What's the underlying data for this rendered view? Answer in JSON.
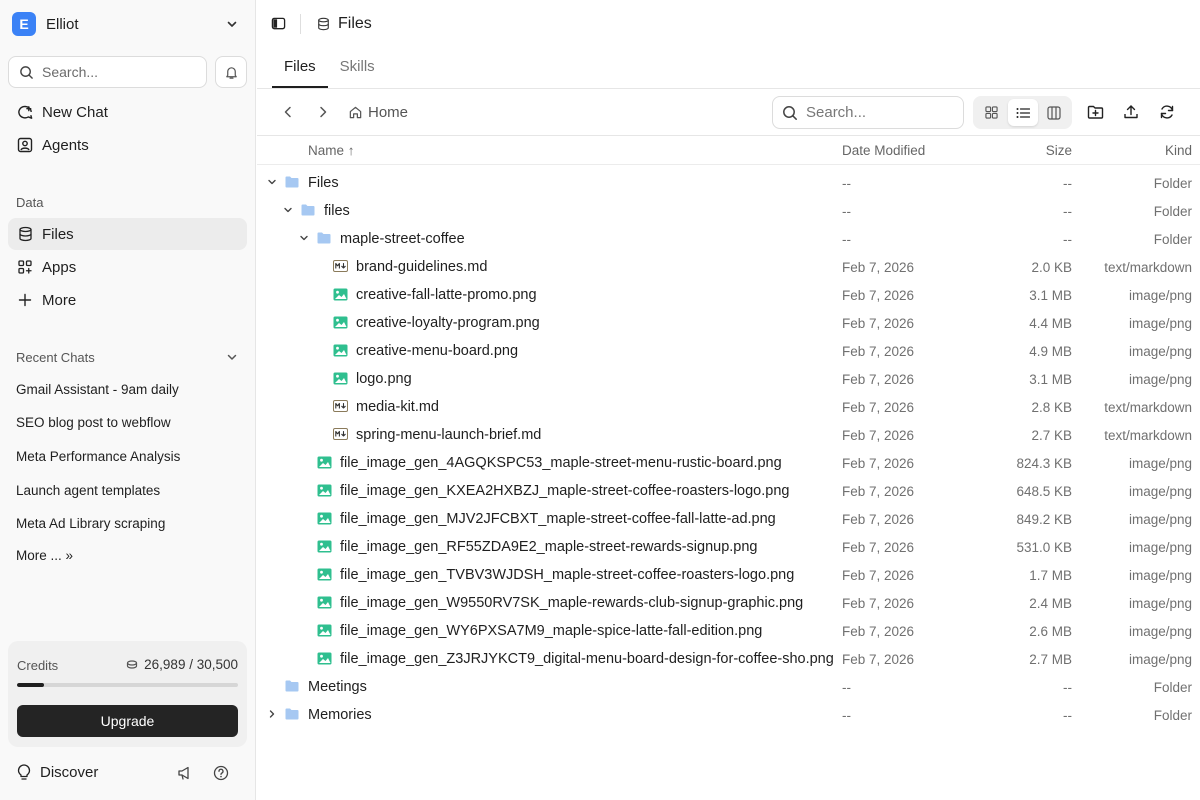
{
  "colors": {
    "accent": "#3b82f6",
    "folder": "#a6c8f2",
    "image": "#2fbf8f",
    "markdown": "#8a7a5a"
  },
  "workspace": {
    "initial": "E",
    "name": "Elliot"
  },
  "sidebar": {
    "search_placeholder": "Search...",
    "nav": [
      {
        "label": "New Chat",
        "icon": "chat-plus-icon"
      },
      {
        "label": "Agents",
        "icon": "agent-icon"
      }
    ],
    "data_label": "Data",
    "data_items": [
      {
        "label": "Files",
        "icon": "database-icon",
        "active": true
      },
      {
        "label": "Apps",
        "icon": "apps-icon"
      },
      {
        "label": "More",
        "icon": "plus-icon"
      }
    ],
    "recent_label": "Recent Chats",
    "recent_chats": [
      "Gmail Assistant - 9am daily",
      "SEO blog post to webflow",
      "Meta Performance Analysis",
      "Launch agent templates",
      "Meta Ad Library scraping"
    ],
    "more_chats": "More ... »",
    "credits": {
      "label": "Credits",
      "value": "26,989 / 30,500",
      "used_fraction": 0.12
    },
    "upgrade": "Upgrade",
    "discover": "Discover"
  },
  "header": {
    "title": "Files",
    "tabs": [
      "Files",
      "Skills"
    ],
    "active_tab": 0
  },
  "toolbar": {
    "home": "Home",
    "search_placeholder": "Search..."
  },
  "table": {
    "columns": {
      "name": "Name ↑",
      "date": "Date Modified",
      "size": "Size",
      "kind": "Kind"
    },
    "rows": [
      {
        "name": "Files",
        "type": "folder",
        "depth": 0,
        "expand": "open",
        "date": "--",
        "size": "--",
        "kind": "Folder"
      },
      {
        "name": "files",
        "type": "folder",
        "depth": 1,
        "expand": "open",
        "date": "--",
        "size": "--",
        "kind": "Folder"
      },
      {
        "name": "maple-street-coffee",
        "type": "folder",
        "depth": 2,
        "expand": "open",
        "date": "--",
        "size": "--",
        "kind": "Folder"
      },
      {
        "name": "brand-guidelines.md",
        "type": "md",
        "depth": 3,
        "date": "Feb 7, 2026",
        "size": "2.0 KB",
        "kind": "text/markdown"
      },
      {
        "name": "creative-fall-latte-promo.png",
        "type": "png",
        "depth": 3,
        "date": "Feb 7, 2026",
        "size": "3.1 MB",
        "kind": "image/png"
      },
      {
        "name": "creative-loyalty-program.png",
        "type": "png",
        "depth": 3,
        "date": "Feb 7, 2026",
        "size": "4.4 MB",
        "kind": "image/png"
      },
      {
        "name": "creative-menu-board.png",
        "type": "png",
        "depth": 3,
        "date": "Feb 7, 2026",
        "size": "4.9 MB",
        "kind": "image/png"
      },
      {
        "name": "logo.png",
        "type": "png",
        "depth": 3,
        "date": "Feb 7, 2026",
        "size": "3.1 MB",
        "kind": "image/png"
      },
      {
        "name": "media-kit.md",
        "type": "md",
        "depth": 3,
        "date": "Feb 7, 2026",
        "size": "2.8 KB",
        "kind": "text/markdown"
      },
      {
        "name": "spring-menu-launch-brief.md",
        "type": "md",
        "depth": 3,
        "date": "Feb 7, 2026",
        "size": "2.7 KB",
        "kind": "text/markdown"
      },
      {
        "name": "file_image_gen_4AGQKSPC53_maple-street-menu-rustic-board.png",
        "type": "png",
        "depth": 2,
        "date": "Feb 7, 2026",
        "size": "824.3 KB",
        "kind": "image/png"
      },
      {
        "name": "file_image_gen_KXEA2HXBZJ_maple-street-coffee-roasters-logo.png",
        "type": "png",
        "depth": 2,
        "date": "Feb 7, 2026",
        "size": "648.5 KB",
        "kind": "image/png"
      },
      {
        "name": "file_image_gen_MJV2JFCBXT_maple-street-coffee-fall-latte-ad.png",
        "type": "png",
        "depth": 2,
        "date": "Feb 7, 2026",
        "size": "849.2 KB",
        "kind": "image/png"
      },
      {
        "name": "file_image_gen_RF55ZDA9E2_maple-street-rewards-signup.png",
        "type": "png",
        "depth": 2,
        "date": "Feb 7, 2026",
        "size": "531.0 KB",
        "kind": "image/png"
      },
      {
        "name": "file_image_gen_TVBV3WJDSH_maple-street-coffee-roasters-logo.png",
        "type": "png",
        "depth": 2,
        "date": "Feb 7, 2026",
        "size": "1.7 MB",
        "kind": "image/png"
      },
      {
        "name": "file_image_gen_W9550RV7SK_maple-rewards-club-signup-graphic.png",
        "type": "png",
        "depth": 2,
        "date": "Feb 7, 2026",
        "size": "2.4 MB",
        "kind": "image/png"
      },
      {
        "name": "file_image_gen_WY6PXSA7M9_maple-spice-latte-fall-edition.png",
        "type": "png",
        "depth": 2,
        "date": "Feb 7, 2026",
        "size": "2.6 MB",
        "kind": "image/png"
      },
      {
        "name": "file_image_gen_Z3JRJYKCT9_digital-menu-board-design-for-coffee-sho.png",
        "type": "png",
        "depth": 2,
        "date": "Feb 7, 2026",
        "size": "2.7 MB",
        "kind": "image/png"
      },
      {
        "name": "Meetings",
        "type": "folder",
        "depth": 0,
        "expand": "none",
        "date": "--",
        "size": "--",
        "kind": "Folder"
      },
      {
        "name": "Memories",
        "type": "folder",
        "depth": 0,
        "expand": "closed",
        "date": "--",
        "size": "--",
        "kind": "Folder"
      }
    ]
  }
}
